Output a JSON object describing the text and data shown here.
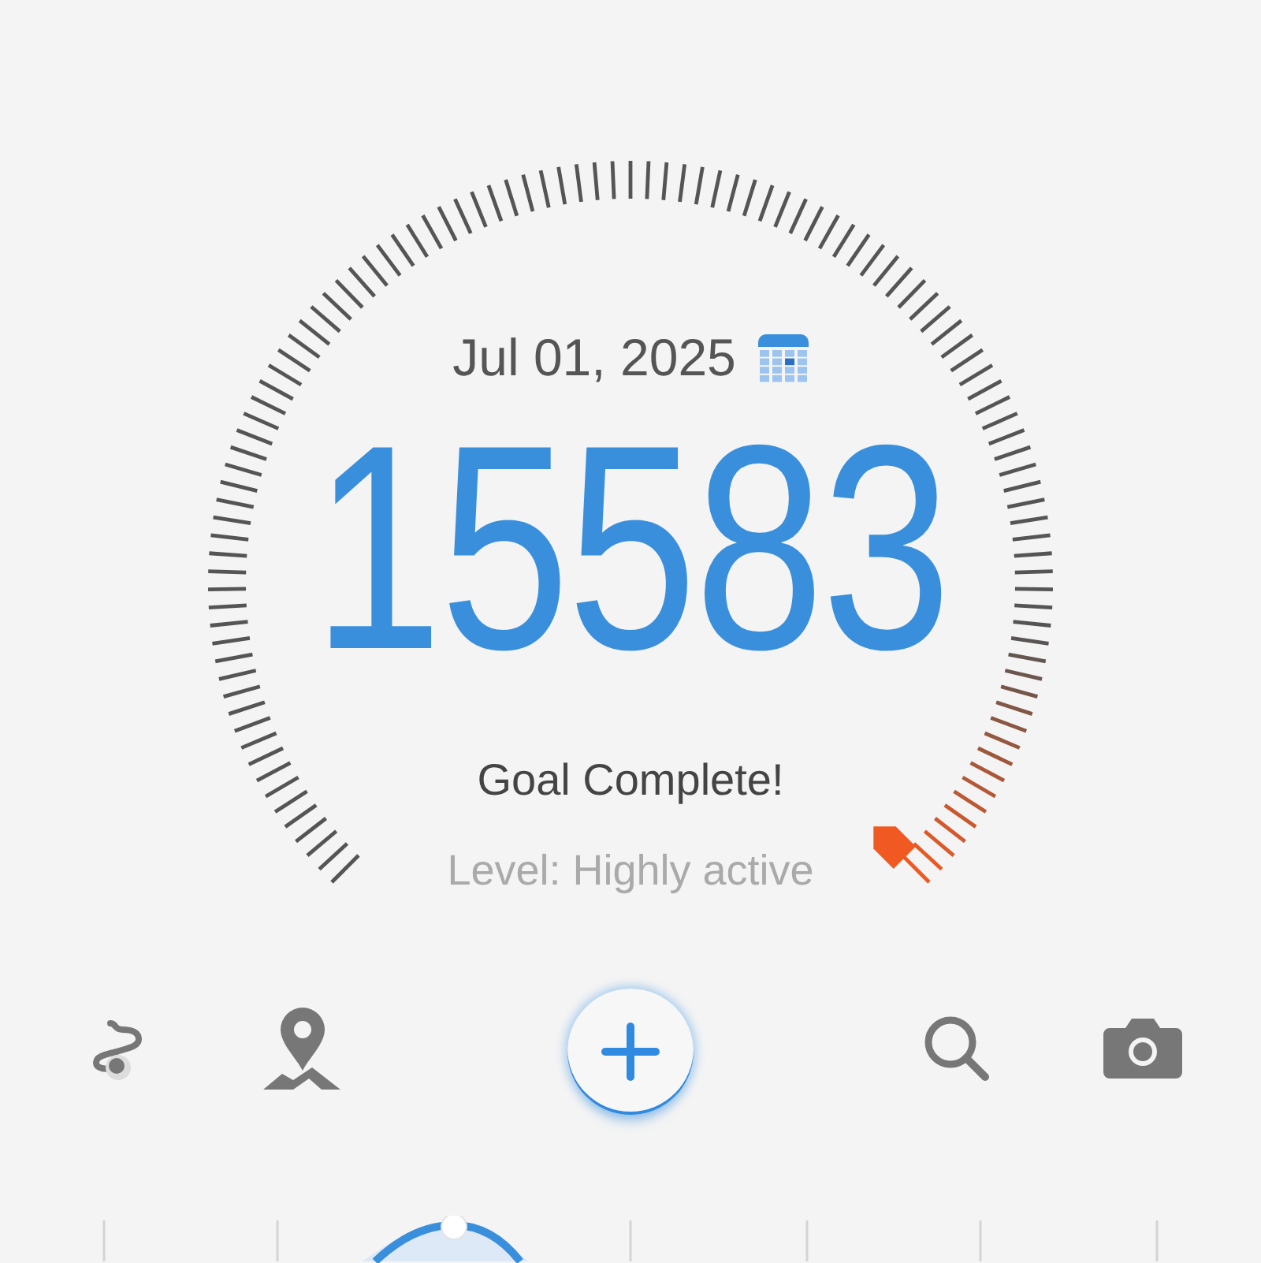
{
  "date": "Jul 01, 2025",
  "steps": "15583",
  "goal_message": "Goal Complete!",
  "activity": "Level: Highly active"
}
